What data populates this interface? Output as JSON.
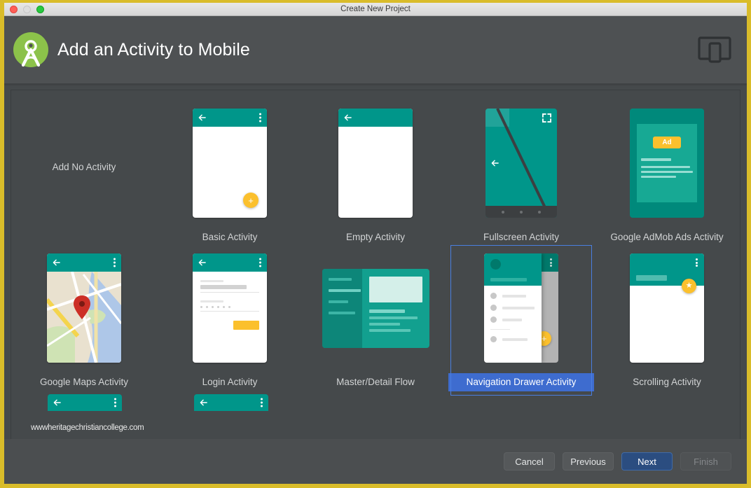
{
  "window": {
    "title": "Create New Project",
    "controls": [
      "close",
      "minimize",
      "zoom"
    ]
  },
  "header": {
    "title": "Add an Activity to Mobile",
    "logo_icon": "android-studio-logo",
    "device_icon": "mobile-and-tablet-icon"
  },
  "activities": {
    "row1": [
      {
        "label": "Add No Activity",
        "thumb": "none",
        "selected": false
      },
      {
        "label": "Basic Activity",
        "thumb": "basic",
        "selected": false
      },
      {
        "label": "Empty Activity",
        "thumb": "empty",
        "selected": false
      },
      {
        "label": "Fullscreen Activity",
        "thumb": "fullscreen",
        "selected": false
      },
      {
        "label": "Google AdMob Ads Activity",
        "thumb": "admob",
        "selected": false
      }
    ],
    "row2": [
      {
        "label": "Google Maps Activity",
        "thumb": "maps",
        "selected": false
      },
      {
        "label": "Login Activity",
        "thumb": "login",
        "selected": false
      },
      {
        "label": "Master/Detail Flow",
        "thumb": "masterdetail",
        "selected": false
      },
      {
        "label": "Navigation Drawer Activity",
        "thumb": "navdrawer",
        "selected": true
      },
      {
        "label": "Scrolling Activity",
        "thumb": "scrolling",
        "selected": false
      }
    ]
  },
  "admob": {
    "badge": "Ad"
  },
  "watermark": "wwwheritagechristiancollege.com",
  "footer": {
    "cancel": "Cancel",
    "previous": "Previous",
    "next": "Next",
    "finish": "Finish"
  },
  "colors": {
    "teal": "#009688",
    "teal_dark": "#00796b",
    "accent_yellow": "#fbc02d",
    "selection_blue": "#3e6ccf",
    "frame_yellow": "#d9bc2a",
    "panel_gray": "#45494b"
  }
}
